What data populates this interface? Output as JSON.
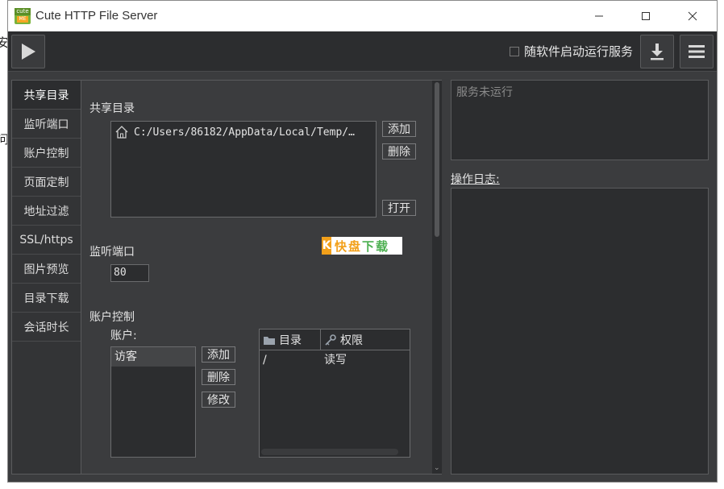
{
  "desktop": {
    "edge_chars": [
      "安",
      "问"
    ]
  },
  "window": {
    "title": "Cute HTTP File Server",
    "icon_top_text": "cute",
    "icon_bottom_text": "ME"
  },
  "toolbar": {
    "autostart_label": "随软件启动运行服务",
    "autostart_checked": false
  },
  "nav": {
    "items": [
      {
        "label": "共享目录",
        "active": true
      },
      {
        "label": "监听端口"
      },
      {
        "label": "账户控制"
      },
      {
        "label": "页面定制"
      },
      {
        "label": "地址过滤"
      },
      {
        "label": "SSL/https"
      },
      {
        "label": "图片预览"
      },
      {
        "label": "目录下载"
      },
      {
        "label": "会话时长"
      }
    ]
  },
  "shared_dir": {
    "title": "共享目录",
    "path": "C:/Users/86182/AppData/Local/Temp/…",
    "add_label": "添加",
    "delete_label": "删除",
    "open_label": "打开"
  },
  "listen_port": {
    "title": "监听端口",
    "value": "80"
  },
  "watermark": {
    "mark": "K",
    "text_a": "快盘",
    "text_b": "下载"
  },
  "account_control": {
    "title": "账户控制",
    "accounts_label": "账户:",
    "accounts": [
      "访客"
    ],
    "add_label": "添加",
    "delete_label": "删除",
    "edit_label": "修改",
    "table": {
      "col_dir": "目录",
      "col_perm": "权限",
      "rows": [
        {
          "dir": "/",
          "perm": "读写"
        }
      ]
    }
  },
  "status": {
    "text": "服务未运行"
  },
  "log": {
    "label": "操作日志:"
  },
  "colors": {
    "window_bg": "#3b3c3e",
    "panel_bg": "#2c2d2f",
    "brand_green": "#79b33a",
    "brand_orange": "#f2a01a"
  }
}
